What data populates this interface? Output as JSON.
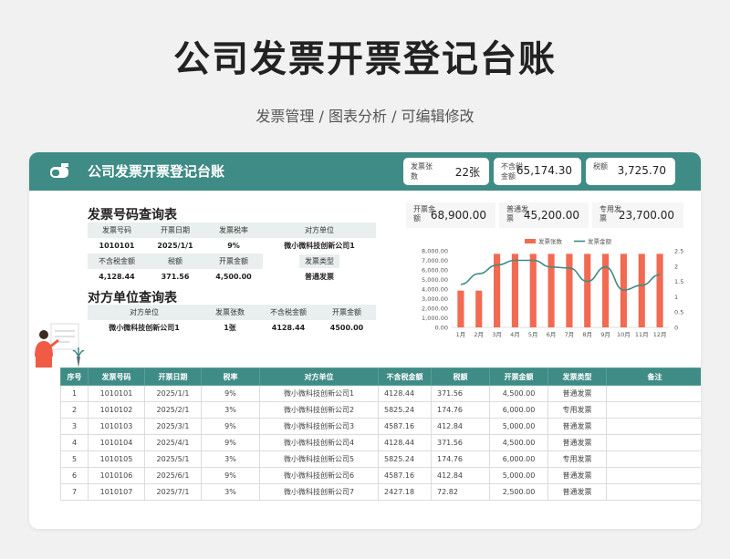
{
  "page": {
    "title": "公司发票开票登记台账",
    "subtitle": "发票管理 / 图表分析 / 可编辑修改"
  },
  "header": {
    "title": "公司发票开票登记台账",
    "kpis": [
      {
        "label": "发票张数",
        "value": "22张"
      },
      {
        "label": "不含税金额",
        "value": "65,174.30"
      },
      {
        "label": "税额",
        "value": "3,725.70"
      }
    ]
  },
  "invoice_query": {
    "title": "发票号码查询表",
    "row1_headers": [
      "发票号码",
      "开票日期",
      "发票税率",
      "对方单位"
    ],
    "row1_values": [
      "1010101",
      "2025/1/1",
      "9%",
      "微小微科技创新公司1"
    ],
    "row2_headers": [
      "不含税金额",
      "税额",
      "开票金额",
      "发票类型"
    ],
    "row2_values": [
      "4,128.44",
      "371.56",
      "4,500.00",
      "普通发票"
    ]
  },
  "party_query": {
    "title": "对方单位查询表",
    "headers": [
      "对方单位",
      "发票张数",
      "不含税金额",
      "开票金额"
    ],
    "values": [
      "微小微科技创新公司1",
      "1张",
      "4128.44",
      "4500.00"
    ]
  },
  "summary": [
    {
      "label": "开票金额",
      "value": "68,900.00"
    },
    {
      "label": "普通发票",
      "value": "45,200.00"
    },
    {
      "label": "专用发票",
      "value": "23,700.00"
    }
  ],
  "colors": {
    "teal": "#3f8b85",
    "bar": "#f26a52",
    "line": "#3f8b85"
  },
  "chart_data": {
    "type": "bar",
    "categories": [
      "1月",
      "2月",
      "3月",
      "4月",
      "5月",
      "6月",
      "7月",
      "8月",
      "9月",
      "10月",
      "11月",
      "12月"
    ],
    "series": [
      {
        "name": "发票张数",
        "axis": "right",
        "values": [
          1.2,
          1.2,
          2.4,
          2.4,
          2.4,
          2.4,
          2.4,
          2.4,
          2.4,
          2.4,
          2.4,
          2.4
        ]
      },
      {
        "name": "发票金额",
        "axis": "left",
        "type": "line",
        "values": [
          4500,
          5600,
          6500,
          7000,
          7000,
          6300,
          6200,
          4800,
          6300,
          3900,
          4400,
          5500
        ]
      }
    ],
    "ylim_left": [
      0,
      8000
    ],
    "yticks_left": [
      "0.00",
      "1,000.00",
      "2,000.00",
      "3,000.00",
      "4,000.00",
      "5,000.00",
      "6,000.00",
      "7,000.00",
      "8,000.00"
    ],
    "ylim_right": [
      0,
      2.5
    ],
    "yticks_right": [
      "0",
      "0.5",
      "1",
      "1.5",
      "2",
      "2.5"
    ],
    "legend": "top"
  },
  "table": {
    "headers": [
      "序号",
      "发票号码",
      "开票日期",
      "税率",
      "对方单位",
      "不含税金额",
      "税额",
      "开票金额",
      "发票类型",
      "备注"
    ],
    "rows": [
      [
        "1",
        "1010101",
        "2025/1/1",
        "9%",
        "微小微科技创新公司1",
        "4128.44",
        "371.56",
        "4,500.00",
        "普通发票",
        ""
      ],
      [
        "2",
        "1010102",
        "2025/2/1",
        "3%",
        "微小微科技创新公司2",
        "5825.24",
        "174.76",
        "6,000.00",
        "专用发票",
        ""
      ],
      [
        "3",
        "1010103",
        "2025/3/1",
        "9%",
        "微小微科技创新公司3",
        "4587.16",
        "412.84",
        "5,000.00",
        "普通发票",
        ""
      ],
      [
        "4",
        "1010104",
        "2025/4/1",
        "9%",
        "微小微科技创新公司4",
        "4128.44",
        "371.56",
        "4,500.00",
        "普通发票",
        ""
      ],
      [
        "5",
        "1010105",
        "2025/5/1",
        "3%",
        "微小微科技创新公司5",
        "5825.24",
        "174.76",
        "6,000.00",
        "专用发票",
        ""
      ],
      [
        "6",
        "1010106",
        "2025/6/1",
        "9%",
        "微小微科技创新公司6",
        "4587.16",
        "412.84",
        "5,000.00",
        "普通发票",
        ""
      ],
      [
        "7",
        "1010107",
        "2025/7/1",
        "3%",
        "微小微科技创新公司7",
        "2427.18",
        "72.82",
        "2,500.00",
        "普通发票",
        ""
      ]
    ]
  }
}
